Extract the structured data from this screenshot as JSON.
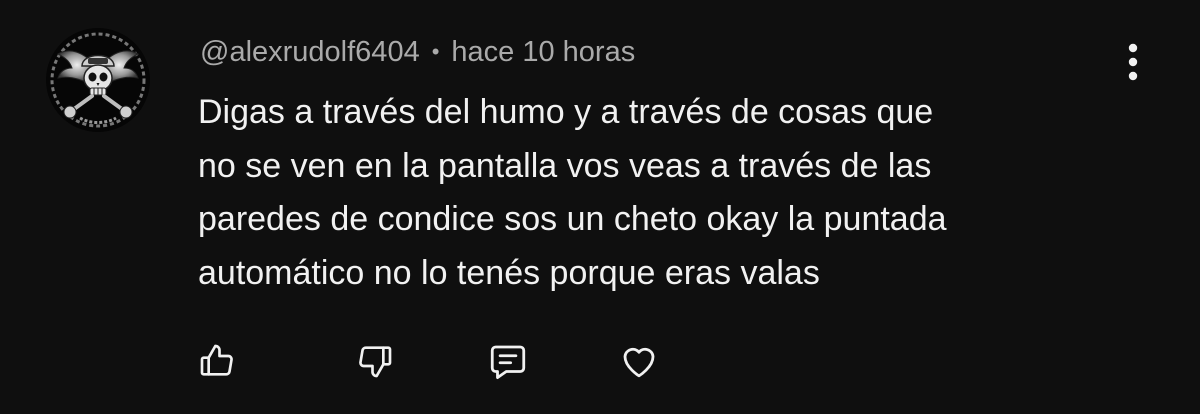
{
  "comment": {
    "author": "@alexrudolf6404",
    "separator": "•",
    "time": "hace 10 horas",
    "text": "Digas a través del humo y a través de cosas que\nno se ven en la pantalla vos veas a través de las\nparedes de condice sos un cheto okay la puntada\nautomático no lo tenés porque eras valas",
    "avatar_icon": "skull-wings-emblem-icon",
    "more_icon": "more-vertical-icon"
  },
  "actions": [
    {
      "icon": "thumb-up-icon"
    },
    {
      "icon": "thumb-down-icon"
    },
    {
      "icon": "reply-comment-icon"
    },
    {
      "icon": "heart-icon"
    }
  ],
  "colors": {
    "background": "#0f0f0f",
    "text": "#f1f1f1",
    "meta": "#aaaaaa"
  }
}
